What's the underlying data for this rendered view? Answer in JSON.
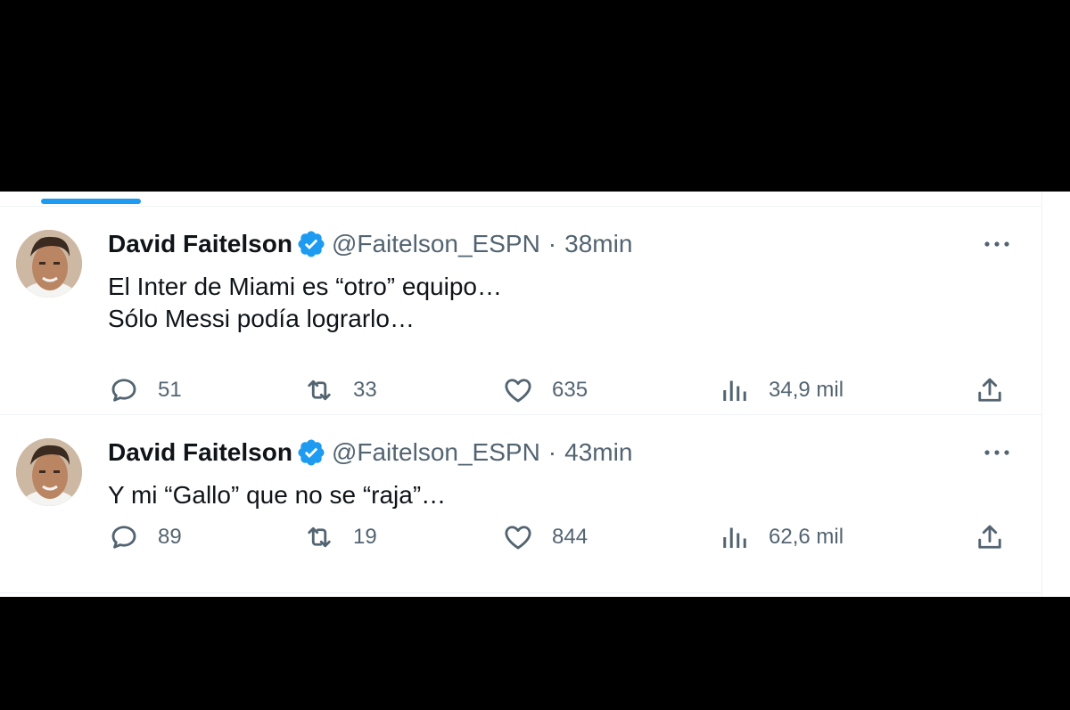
{
  "tweets": [
    {
      "author_name": "David Faitelson",
      "handle": "@Faitelson_ESPN",
      "separator": "·",
      "time": "38min",
      "text_lines": [
        "El Inter de Miami es “otro” equipo…",
        "Sólo Messi podía lograrlo…"
      ],
      "replies": "51",
      "retweets": "33",
      "likes": "635",
      "views": "34,9 mil"
    },
    {
      "author_name": "David Faitelson",
      "handle": "@Faitelson_ESPN",
      "separator": "·",
      "time": "43min",
      "text_lines": [
        "Y mi “Gallo” que no se “raja”…"
      ],
      "replies": "89",
      "retweets": "19",
      "likes": "844",
      "views": "62,6 mil"
    }
  ],
  "icons": {
    "verified": "verified-badge-icon",
    "more": "more-horizontal-icon",
    "reply": "reply-bubble-icon",
    "retweet": "retweet-icon",
    "like": "heart-icon",
    "views": "views-bar-chart-icon",
    "share": "share-upload-icon"
  },
  "colors": {
    "accent": "#1d9bf0",
    "text_primary": "#0f1419",
    "text_secondary": "#536471",
    "divider": "#eff3f4",
    "letterbox": "#000000"
  }
}
